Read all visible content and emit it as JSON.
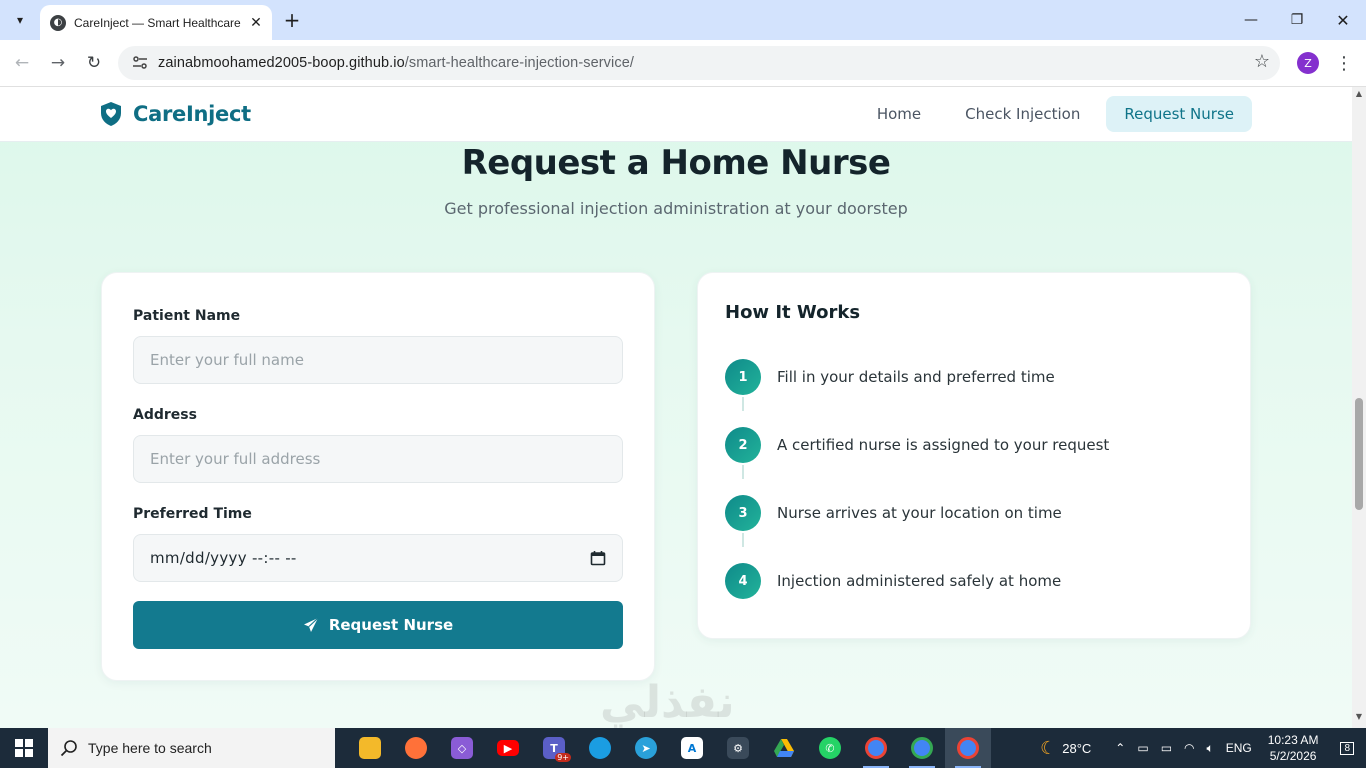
{
  "browser": {
    "tab_title": "CareInject — Smart Healthcare",
    "url_host": "zainabmoohamed2005-boop.github.io",
    "url_path": "/smart-healthcare-injection-service/",
    "profile_initial": "Z"
  },
  "site": {
    "brand": "CareInject",
    "nav": [
      {
        "label": "Home"
      },
      {
        "label": "Check Injection"
      },
      {
        "label": "Request Nurse",
        "active": true
      }
    ]
  },
  "hero": {
    "title": "Request a Home Nurse",
    "subtitle": "Get professional injection administration at your doorstep"
  },
  "form": {
    "patient_name": {
      "label": "Patient Name",
      "placeholder": "Enter your full name"
    },
    "address": {
      "label": "Address",
      "placeholder": "Enter your full address"
    },
    "preferred_time": {
      "label": "Preferred Time",
      "value": "mm/dd/yyyy --:-- --"
    },
    "submit_label": "Request Nurse"
  },
  "how_it_works": {
    "title": "How It Works",
    "steps": [
      {
        "num": "1",
        "text": "Fill in your details and preferred time"
      },
      {
        "num": "2",
        "text": "A certified nurse is assigned to your request"
      },
      {
        "num": "3",
        "text": "Nurse arrives at your location on time"
      },
      {
        "num": "4",
        "text": "Injection administered safely at home"
      }
    ]
  },
  "watermark": "نفذلي",
  "taskbar": {
    "search_placeholder": "Type here to search",
    "teams_badge": "9+",
    "weather": "28°C",
    "language": "ENG",
    "time": "10:23 AM",
    "date": "5/2/2026",
    "notifications": "8"
  },
  "colors": {
    "brand": "#0f6e84",
    "button": "#137a8f",
    "step_gradient_start": "#0f8a8a",
    "step_gradient_end": "#22b39a"
  }
}
